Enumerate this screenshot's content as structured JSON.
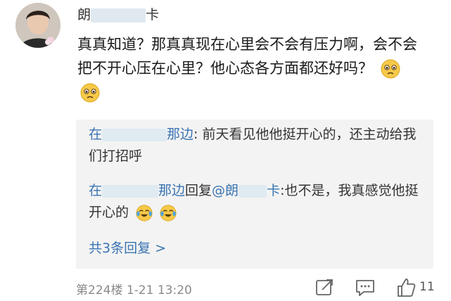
{
  "comment": {
    "username_prefix": "朗",
    "username_suffix": "卡",
    "text": "真真知道？那真真现在心里会不会有压力啊，会不会把不开心压在心里？他心态各方面都还好吗？",
    "meta": "第224楼 1-21 13:20",
    "likes": "11",
    "emoji": [
      "pleading-face",
      "pleading-face"
    ]
  },
  "replies": [
    {
      "name_prefix": "在",
      "name_suffix": "那边",
      "text": ": 前天看见他他挺开心的，还主动给我们打招呼",
      "emoji": []
    },
    {
      "name_prefix": "在",
      "name_suffix": "那边",
      "reply_word": "回复",
      "target_prefix": "@朗",
      "target_suffix": "卡",
      "text": ":也不是，我真感觉他挺开心的",
      "emoji": [
        "tears-of-joy-face",
        "tears-of-joy-face"
      ]
    }
  ],
  "more_replies": "共3条回复 >",
  "colors": {
    "link": "#3a74b3",
    "reply_bg": "#f3f3f3",
    "meta": "#8a8a8a"
  }
}
